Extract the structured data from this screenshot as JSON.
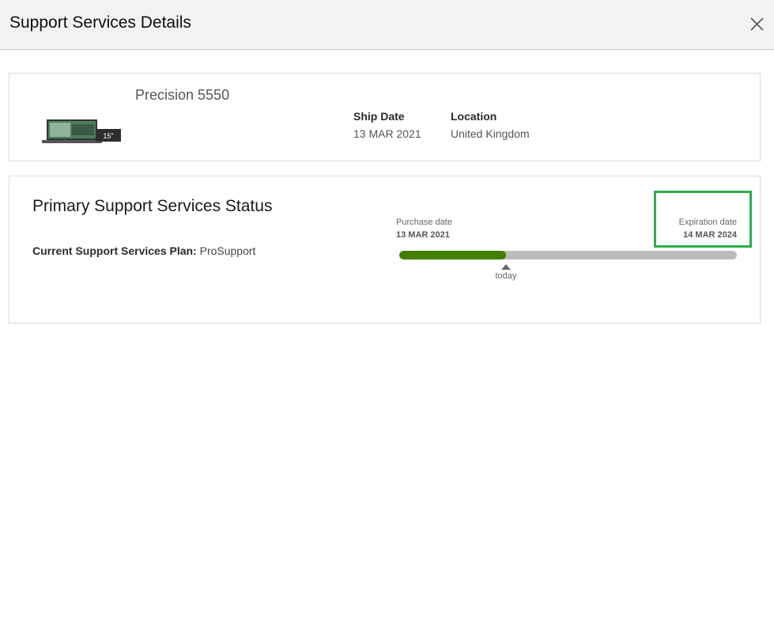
{
  "header": {
    "title": "Support Services Details",
    "close_icon": "close-icon"
  },
  "product": {
    "name": "Precision 5550",
    "image_icon": "laptop-image",
    "image_badge": "15\"",
    "ship_date_label": "Ship Date",
    "ship_date": "13 MAR 2021",
    "location_label": "Location",
    "location": "United Kingdom"
  },
  "status": {
    "title": "Primary Support Services Status",
    "plan_label": "Current Support Services Plan:",
    "plan_value": "ProSupport",
    "purchase_label": "Purchase date",
    "purchase_date": "13 MAR 2021",
    "expiration_label": "Expiration date",
    "expiration_date": "14 MAR 2024",
    "today_label": "today",
    "elapsed_fraction": 0.316,
    "highlight_color": "#2eac4c",
    "progress_color": "#437e08"
  }
}
